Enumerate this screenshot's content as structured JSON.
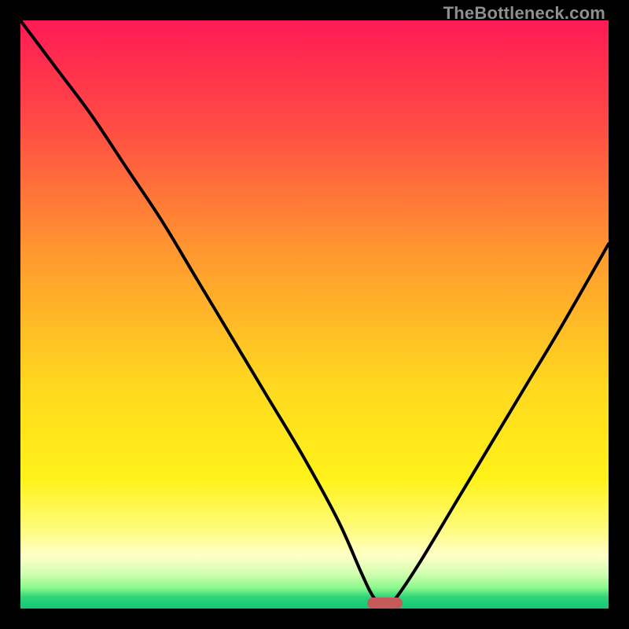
{
  "watermark": {
    "text": "TheBottleneck.com"
  },
  "chart_data": {
    "type": "line",
    "title": "",
    "xlabel": "",
    "ylabel": "",
    "xlim": [
      0,
      100
    ],
    "ylim": [
      0,
      100
    ],
    "grid": false,
    "legend": false,
    "series": [
      {
        "name": "bottleneck-curve",
        "x": [
          0,
          6,
          12,
          18,
          24,
          30,
          36,
          42,
          48,
          54,
          58,
          60,
          62,
          64,
          68,
          74,
          80,
          86,
          92,
          100
        ],
        "values": [
          100,
          92,
          84,
          75,
          66,
          56,
          46,
          36,
          26,
          15,
          6,
          2,
          0,
          2,
          8,
          18,
          28,
          38,
          48,
          62
        ]
      }
    ],
    "marker": {
      "name": "optimal-range",
      "x_start": 59,
      "x_end": 65,
      "y": 0,
      "color": "#c65a5a"
    },
    "background_gradient": {
      "stops": [
        {
          "pct": 0,
          "color": "#ff1a55"
        },
        {
          "pct": 18,
          "color": "#ff4c44"
        },
        {
          "pct": 40,
          "color": "#ff9a2f"
        },
        {
          "pct": 62,
          "color": "#ffd81f"
        },
        {
          "pct": 78,
          "color": "#fff21a"
        },
        {
          "pct": 86,
          "color": "#fffb77"
        },
        {
          "pct": 91,
          "color": "#ffffc8"
        },
        {
          "pct": 94,
          "color": "#d2ffb0"
        },
        {
          "pct": 96.5,
          "color": "#8cf78c"
        },
        {
          "pct": 98,
          "color": "#32d47a"
        },
        {
          "pct": 100,
          "color": "#11c776"
        }
      ]
    }
  }
}
